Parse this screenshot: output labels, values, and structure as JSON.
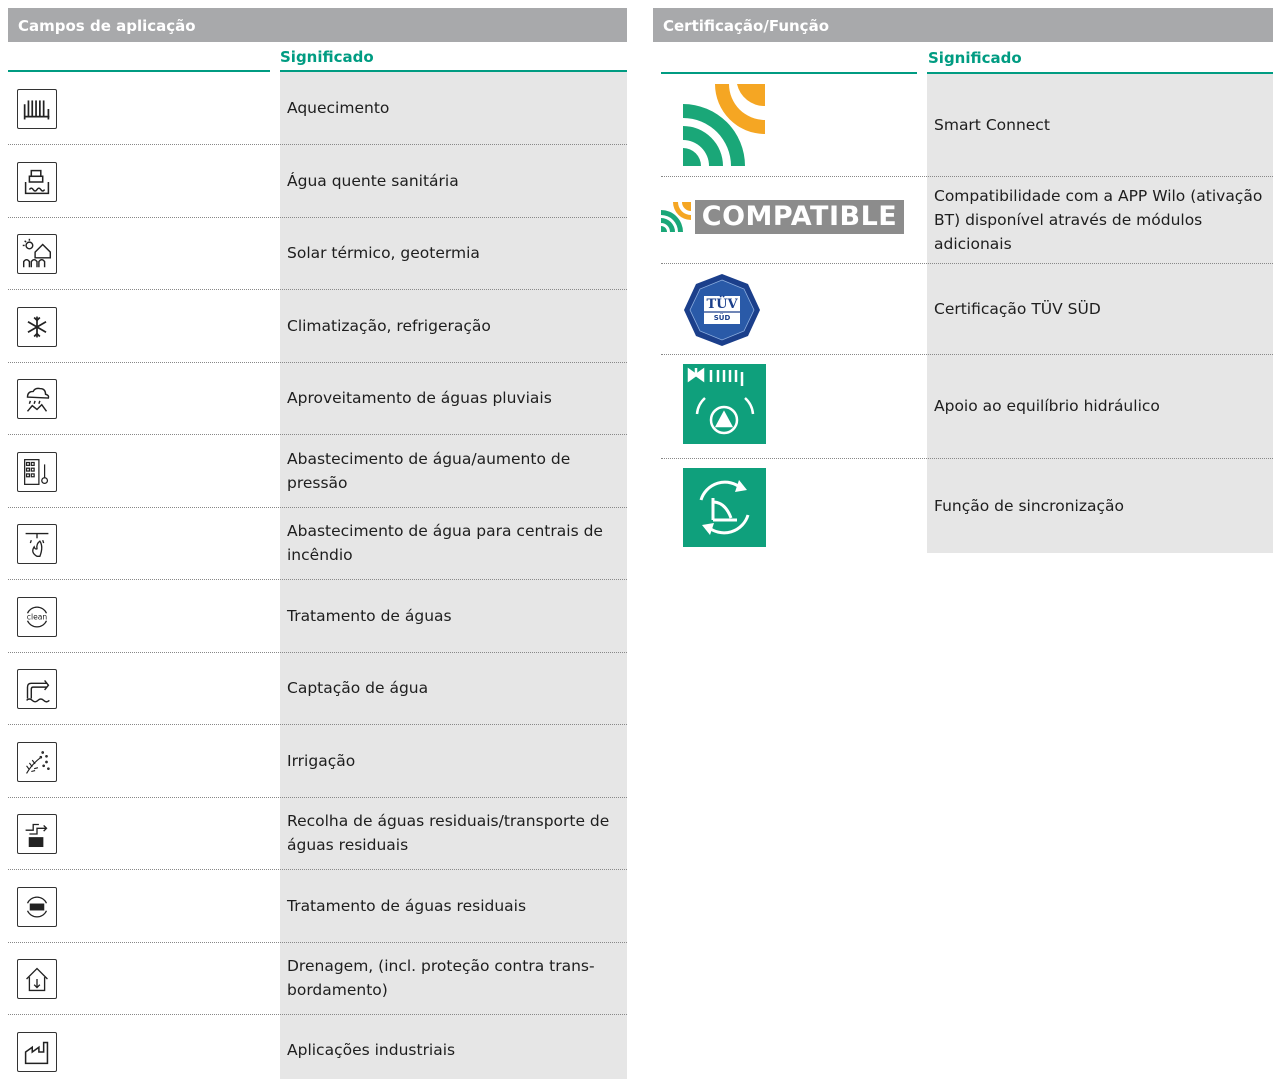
{
  "left": {
    "header": "Campos de aplicação",
    "col_header": "Significado",
    "rows": [
      {
        "icon": "radiator-icon",
        "text": "Aquecimento"
      },
      {
        "icon": "hot-water-icon",
        "text": "Água quente sanitária"
      },
      {
        "icon": "solar-geothermal-icon",
        "text": "Solar térmico, geotermia"
      },
      {
        "icon": "snowflake-icon",
        "text": "Climatização, refrigeração"
      },
      {
        "icon": "rain-icon",
        "text": "Aproveitamento de águas pluviais"
      },
      {
        "icon": "building-pressure-icon",
        "text": "Abastecimento de água/aumento de pressão"
      },
      {
        "icon": "fire-sprinkler-icon",
        "text": "Abastecimento de água para centrais de incêndio"
      },
      {
        "icon": "clean-water-icon",
        "text": "Tratamento de águas"
      },
      {
        "icon": "water-intake-icon",
        "text": "Captação de água"
      },
      {
        "icon": "irrigation-icon",
        "text": "Irrigação"
      },
      {
        "icon": "sewage-icon",
        "text": "Recolha de águas residuais/transporte de águas residuais"
      },
      {
        "icon": "wastewater-treatment-icon",
        "text": "Tratamento de águas residuais"
      },
      {
        "icon": "drainage-icon",
        "text": "Drenagem, (incl. proteção contra trans­bordamento)"
      },
      {
        "icon": "factory-icon",
        "text": "Aplicações industriais"
      }
    ]
  },
  "right": {
    "header": "Certificação/Função",
    "col_header": "Significado",
    "compatible_label": "COMPATIBLE",
    "tuv_label": "TÜV",
    "tuv_sub": "SÜD",
    "rows": [
      {
        "icon": "smart-connect-icon",
        "text": "Smart Connect"
      },
      {
        "icon": "compatible-logo",
        "text": "Compatibilidade com a APP Wilo (ativação BT) disponível através de módulos adicionais"
      },
      {
        "icon": "tuv-sud-seal",
        "text": "Certificação TÜV SÜD"
      },
      {
        "icon": "hydraulic-balance-icon",
        "text": "Apoio ao equilíbrio hidráulico"
      },
      {
        "icon": "sync-function-icon",
        "text": "Função de sincronização"
      }
    ]
  },
  "colors": {
    "header_bg": "#a8a9ab",
    "accent": "#009c82",
    "smart_green": "#1aa778",
    "smart_orange": "#f5a623",
    "gray_col": "#e6e6e6"
  }
}
